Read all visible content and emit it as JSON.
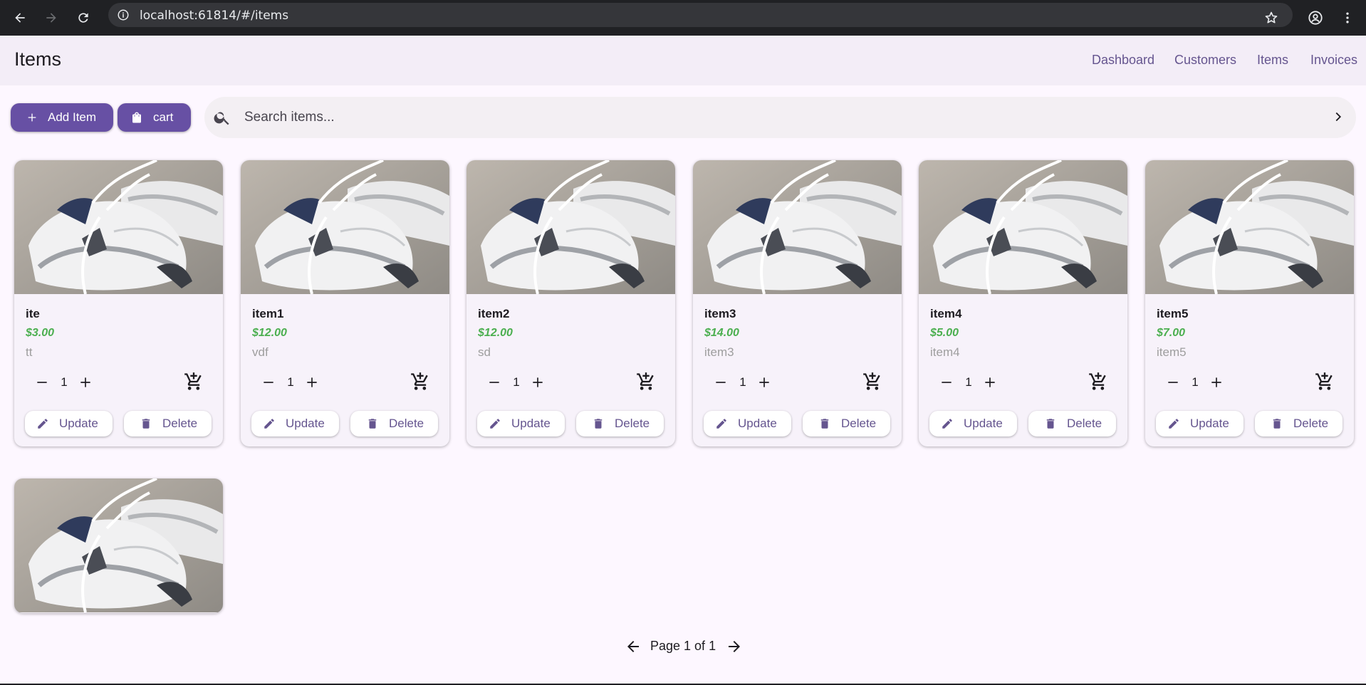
{
  "browser": {
    "url": "localhost:61814/#/items"
  },
  "appbar": {
    "title": "Items",
    "nav": [
      "Dashboard",
      "Customers",
      "Items",
      "Invoices"
    ]
  },
  "actions": {
    "add_label": "Add Item",
    "cart_label": "cart"
  },
  "search": {
    "placeholder": "Search items..."
  },
  "card_buttons": {
    "update_label": "Update",
    "delete_label": "Delete"
  },
  "items": [
    {
      "name": "ite",
      "price": "$3.00",
      "description": "tt",
      "quantity": "1"
    },
    {
      "name": "item1",
      "price": "$12.00",
      "description": "vdf",
      "quantity": "1"
    },
    {
      "name": "item2",
      "price": "$12.00",
      "description": "sd",
      "quantity": "1"
    },
    {
      "name": "item3",
      "price": "$14.00",
      "description": "item3",
      "quantity": "1"
    },
    {
      "name": "item4",
      "price": "$5.00",
      "description": "item4",
      "quantity": "1"
    },
    {
      "name": "item5",
      "price": "$7.00",
      "description": "item5",
      "quantity": "1"
    },
    {
      "name": "",
      "price": "",
      "description": "",
      "quantity": ""
    }
  ],
  "pagination": {
    "label": "Page 1 of 1"
  },
  "colors": {
    "primary": "#6750a4",
    "price": "#4caf50",
    "background": "#fdf7ff",
    "appbar": "#f3edf7"
  }
}
